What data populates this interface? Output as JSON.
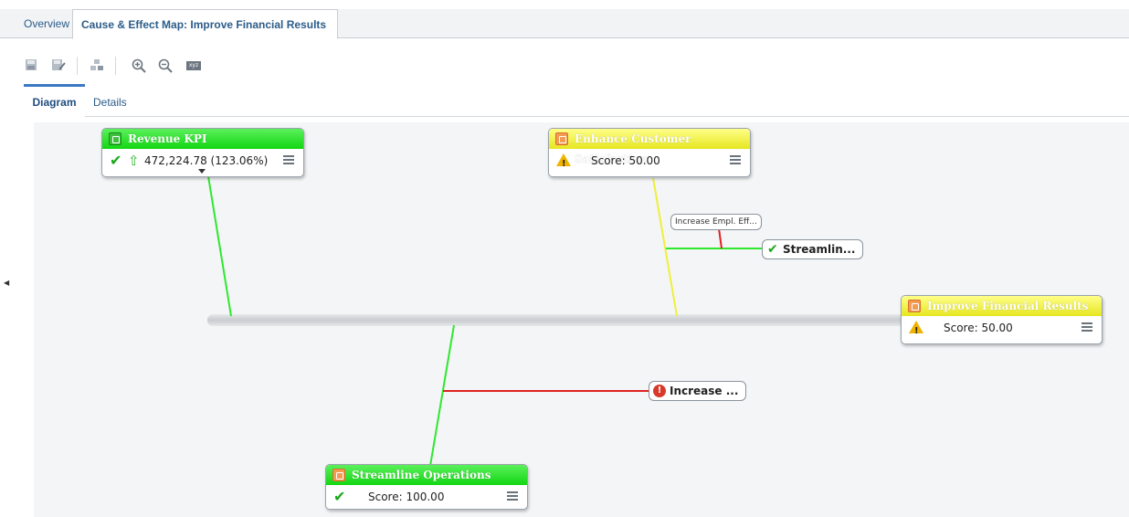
{
  "tabs": [
    {
      "label": "Overview"
    },
    {
      "label": "Cause & Effect Map: Improve Financial Results"
    }
  ],
  "toolbar": {
    "icons": [
      "save-icon",
      "save-as-icon",
      "objects-icon",
      "zoom-in-icon",
      "zoom-out-icon",
      "xyz-icon"
    ],
    "xyz_label": "xyz"
  },
  "subtabs": [
    {
      "label": "Diagram"
    },
    {
      "label": "Details"
    }
  ],
  "nodes": {
    "revenue_kpi": {
      "title": "Revenue KPI",
      "value": "472,224.78 (123.06%)",
      "status": "ok",
      "trend": "up"
    },
    "enhance_cs": {
      "title": "Enhance Customer Satisfaction",
      "score": "Score: 50.00",
      "status": "warning"
    },
    "improve_fr": {
      "title": "Improve Financial Results",
      "score": "Score: 50.00",
      "status": "warning"
    },
    "streamline_ops": {
      "title": "Streamline Operations",
      "score": "Score: 100.00",
      "status": "ok"
    }
  },
  "pills": {
    "increase_empl": "Increase Empl. Eff...",
    "streamlin": "Streamlin...",
    "increase": "Increase ..."
  },
  "colors": {
    "green": "#12d612",
    "yellow": "#e6e620",
    "red": "#e02020",
    "spine": "#cfd2d6"
  }
}
